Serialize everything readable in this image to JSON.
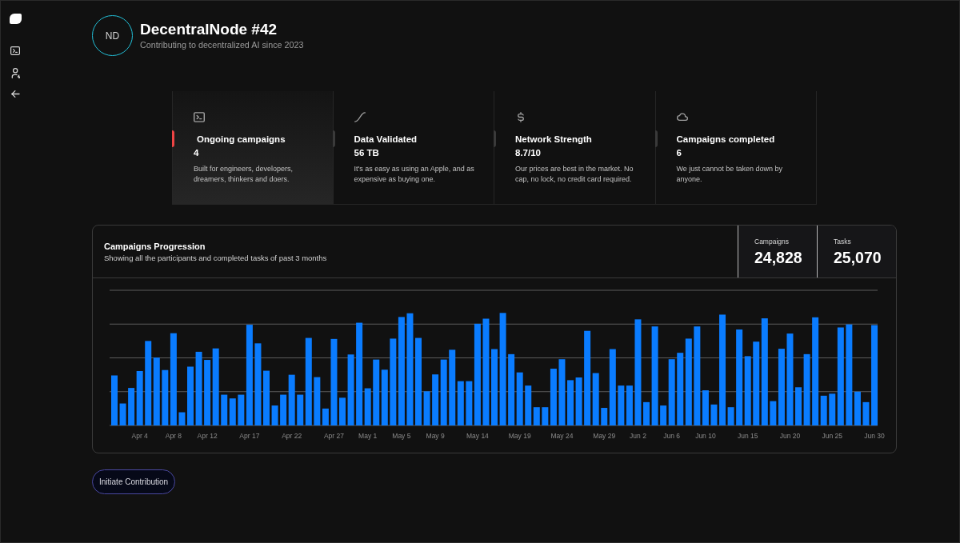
{
  "profile": {
    "initials": "ND",
    "name": "DecentralNode #42",
    "tagline": "Contributing to decentralized AI since 2023"
  },
  "stats": [
    {
      "title": "Ongoing campaigns",
      "value": "4",
      "description": "Built for engineers, developers, dreamers, thinkers and doers.",
      "highlighted": true
    },
    {
      "title": "Data Validated",
      "value": "56 TB",
      "description": "It's as easy as using an Apple, and as expensive as buying one.",
      "highlighted": false
    },
    {
      "title": "Network Strength",
      "value": "8.7/10",
      "description": "Our prices are best in the market. No cap, no lock, no credit card required.",
      "highlighted": false
    },
    {
      "title": "Campaigns completed",
      "value": "6",
      "description": "We just cannot be taken down by anyone.",
      "highlighted": false
    }
  ],
  "chart_panel": {
    "title": "Campaigns Progression",
    "subtitle": "Showing all the participants and completed tasks of past 3 months",
    "totals": [
      {
        "label": "Campaigns",
        "value": "24,828"
      },
      {
        "label": "Tasks",
        "value": "25,070"
      }
    ],
    "x_labels": [
      "Apr 4",
      "Apr 8",
      "Apr 12",
      "Apr 17",
      "Apr 22",
      "Apr 27",
      "May 1",
      "May 5",
      "May 9",
      "May 14",
      "May 19",
      "May 24",
      "May 29",
      "Jun 2",
      "Jun 6",
      "Jun 10",
      "Jun 15",
      "Jun 20",
      "Jun 25",
      "Jun 30"
    ]
  },
  "action_button": {
    "label": "Initiate Contribution"
  }
}
